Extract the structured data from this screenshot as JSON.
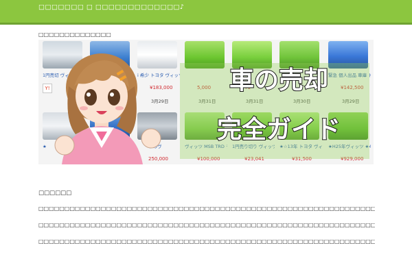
{
  "header": {
    "site_title": "□□□□□□□ □ □□□□□□□□□□□□□♪"
  },
  "breadcrumb": "□□□□□□□□□□□□□□",
  "hero": {
    "title_line1": "車の売却",
    "title_line2": "完全ガイド",
    "listings": [
      {
        "title": "1円売切 ヴィッツ",
        "price": "",
        "date": ""
      },
      {
        "title": "",
        "price": "",
        "date": ""
      },
      {
        "title": "i 希少 トヨタ ヴィッツTRD-MSB",
        "price": "¥183,000",
        "date": "3月29日"
      },
      {
        "title": "",
        "price": "5,000",
        "date": "3月31日"
      },
      {
        "title": "",
        "price": "¥1",
        "date": "3月31日"
      },
      {
        "title": "",
        "price": "",
        "date": "3月30日"
      },
      {
        "title": "緊急 個人出品 車庫 トヨタ ヴィッツ R",
        "price": "¥142,500",
        "date": "3月29日"
      },
      {
        "title": "★",
        "price": "",
        "date": ""
      },
      {
        "title": "",
        "price": "",
        "date": ""
      },
      {
        "title": "きのヴ",
        "price": "250,000",
        "date": ""
      },
      {
        "title": "ヴィッツ MSB TRD ラリー仕様 サイ",
        "price": "¥100,000",
        "date": ""
      },
      {
        "title": "1円売り切り ヴィッツ 走行６５７０",
        "price": "¥23,041",
        "date": ""
      },
      {
        "title": "★☆13年 トヨタ ヴィッツ（VITZ）",
        "price": "¥31,500",
        "date": ""
      },
      {
        "title": "★H25年ヴィッツ ★4WD★低走1万",
        "price": "¥929,000",
        "date": ""
      }
    ]
  },
  "article": {
    "heading": "□□□□□□",
    "paragraphs": [
      "□□□□□□□□□□□□□□□□□□□□□□□□□□□□□□□□□□□□□□□□□□□□□□□□□□□□□□□□□□□□□□□□□□□□□□□□□□□□□□□□",
      "□□□□□□□□□□□□□□□□□□□□□□□□□□□□□□□□□□□□□□□□□□□□□□□□□□□□□□□□□□□□□□□□□□□□□□□□□□□□□□□□",
      "□□□□□□□□□□□□□□□□□□□□□□□□□□□□□□□□□□□□□□□□□□□□□□□□□□□□□□□□□□□□□□□□□□□□□□□□□□□□□"
    ]
  }
}
